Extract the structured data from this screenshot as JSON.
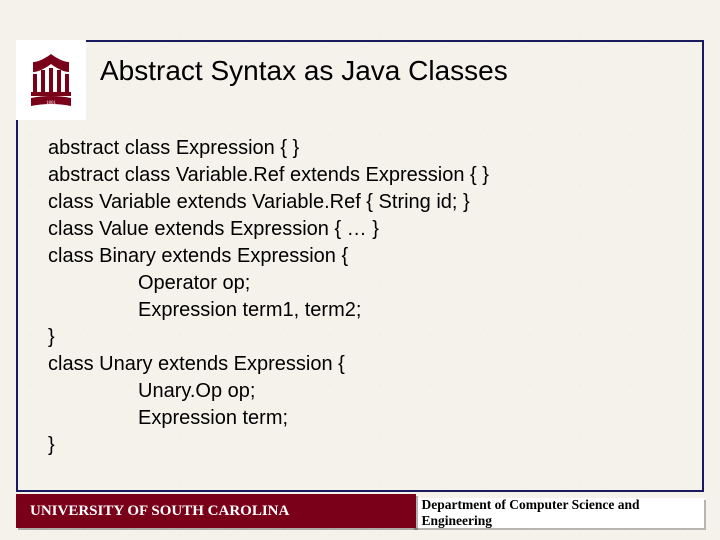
{
  "title": "Abstract Syntax as Java Classes",
  "code": {
    "l1": "abstract class Expression { }",
    "l2": "abstract class Variable.Ref extends Expression { }",
    "l3": "class Variable extends Variable.Ref { String id; }",
    "l4": "class Value extends Expression { … }",
    "l5": "class Binary extends Expression {",
    "l6": "Operator op;",
    "l7": "Expression term1, term2;",
    "l8": "}",
    "l9": "class Unary extends Expression {",
    "l10": "Unary.Op op;",
    "l11": "Expression term;",
    "l12": "}"
  },
  "footer": {
    "left": "UNIVERSITY OF SOUTH CAROLINA",
    "right": "Department of Computer Science and Engineering"
  }
}
